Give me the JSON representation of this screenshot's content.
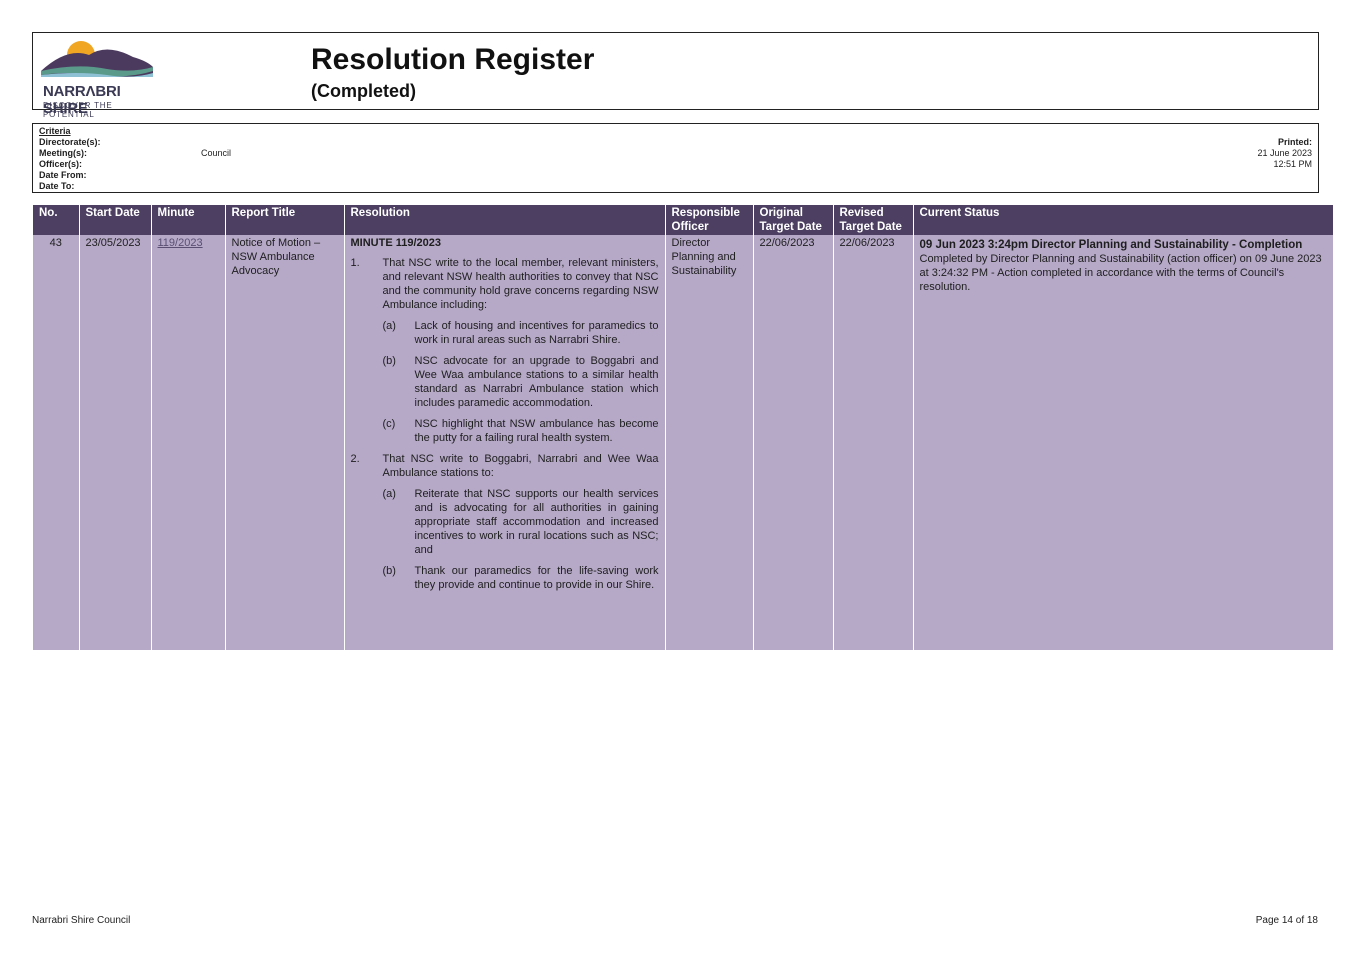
{
  "header": {
    "logo_name": "NARRΛBRI SHIRE",
    "logo_tagline": "DISCOVER THE POTENTIAL",
    "title": "Resolution Register",
    "subtitle": "(Completed)"
  },
  "criteria": {
    "heading": "Criteria",
    "directorate_label": "Directorate(s):",
    "meeting_label": "Meeting(s):",
    "meeting_value": "Council",
    "officer_label": "Officer(s):",
    "date_from_label": "Date From:",
    "date_to_label": "Date To:",
    "printed_label": "Printed:",
    "printed_date": "21 June 2023",
    "printed_time": "12:51 PM"
  },
  "table": {
    "columns": [
      "No.",
      "Start Date",
      "Minute",
      "Report Title",
      "Resolution",
      "Responsible Officer",
      "Original Target Date",
      "Revised Target Date",
      "Current Status"
    ],
    "row": {
      "no": "43",
      "start_date": "23/05/2023",
      "minute": "119/2023",
      "report_title": "Notice of Motion – NSW Ambulance Advocacy",
      "resolution_heading": "MINUTE 119/2023",
      "item1_num": "1.",
      "item1_text": "That NSC write to the local member, relevant ministers, and relevant NSW health authorities to convey that NSC and the community hold grave concerns regarding NSW Ambulance including:",
      "item1a_num": "(a)",
      "item1a_text": "Lack of housing and incentives for paramedics to work in rural areas such as Narrabri Shire.",
      "item1b_num": "(b)",
      "item1b_text": "NSC advocate for an upgrade to Boggabri and Wee Waa ambulance stations to a similar health standard as Narrabri Ambulance station which includes paramedic accommodation.",
      "item1c_num": "(c)",
      "item1c_text": "NSC highlight that NSW ambulance has become the putty for a failing rural health system.",
      "item2_num": "2.",
      "item2_text": "That NSC write to Boggabri, Narrabri and Wee Waa Ambulance stations to:",
      "item2a_num": "(a)",
      "item2a_text": "Reiterate that NSC supports our health services and is advocating for all authorities in gaining appropriate staff accommodation and increased incentives to work in rural locations such as NSC; and",
      "item2b_num": "(b)",
      "item2b_text": "Thank our paramedics for the life-saving work they provide and continue to provide in our Shire.",
      "responsible_officer": "Director Planning and Sustainability",
      "original_target_date": "22/06/2023",
      "revised_target_date": "22/06/2023",
      "status_heading": "09 Jun 2023 3:24pm Director Planning and Sustainability - Completion",
      "status_body": "Completed by Director Planning and Sustainability (action officer) on 09 June 2023 at 3:24:32 PM - Action completed in accordance with the terms of Council's resolution."
    }
  },
  "footer": {
    "left": "Narrabri Shire Council",
    "right": "Page 14 of 18"
  },
  "colors": {
    "header_bg": "#4c3f61",
    "row_bg": "#b6a9c8",
    "logo_sun": "#f0a623",
    "logo_hill_dark": "#4b3a5e",
    "logo_hill_teal": "#5a9a8a"
  }
}
